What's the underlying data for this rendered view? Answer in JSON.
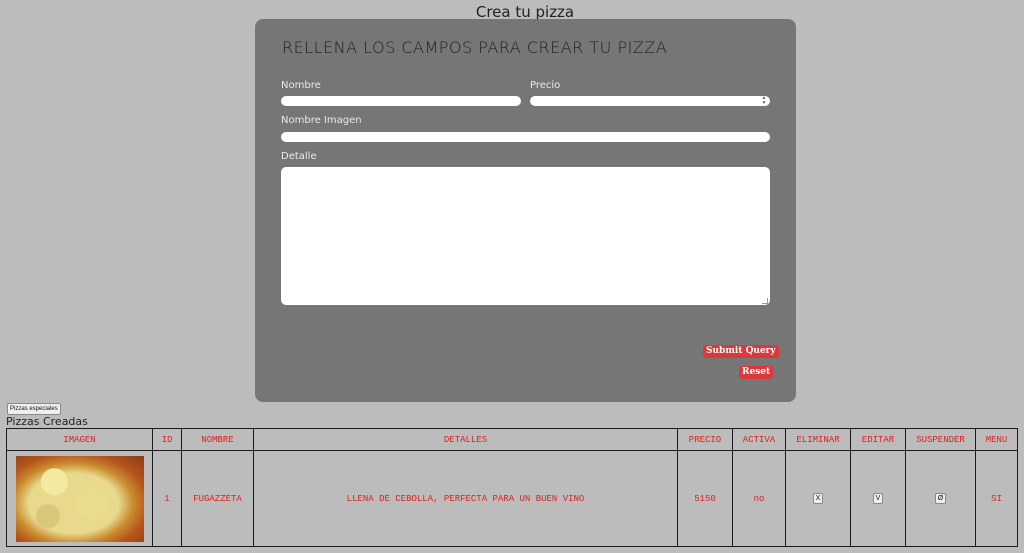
{
  "page": {
    "title": "Crea tu pizza"
  },
  "form": {
    "heading": "RELLENA LOS CAMPOS PARA CREAR TU PIZZA",
    "fields": {
      "nombre": {
        "label": "Nombre",
        "value": ""
      },
      "precio": {
        "label": "Precio",
        "value": ""
      },
      "imagen": {
        "label": "Nombre Imagen",
        "value": ""
      },
      "detalle": {
        "label": "Detalle",
        "value": ""
      }
    },
    "submit_label": "Submit Query",
    "reset_label": "Reset"
  },
  "specials_button": {
    "label": "Pizzas especiales"
  },
  "table": {
    "section_title": "Pizzas Creadas",
    "headers": [
      "IMAGEN",
      "ID",
      "NOMBRE",
      "DETALLES",
      "PRECIO",
      "ACTIVA",
      "ELIMINAR",
      "EDITAR",
      "SUSPENDER",
      "MENU"
    ],
    "rows": [
      {
        "image_icon": "fugazzeta-pizza-photo",
        "id": "1",
        "nombre": "FUGAZZETA",
        "detalles": "LLENA DE CEBOLLA, PERFECTA PARA UN BUEN VINO",
        "precio": "5150",
        "activa": "no",
        "eliminar": "X",
        "editar": "V",
        "suspender": "Ø",
        "menu": "SI"
      }
    ]
  },
  "colors": {
    "background": "#bcbcbc",
    "panel": "#767676",
    "accent_red": "#d9393b",
    "table_text": "#e02020"
  }
}
